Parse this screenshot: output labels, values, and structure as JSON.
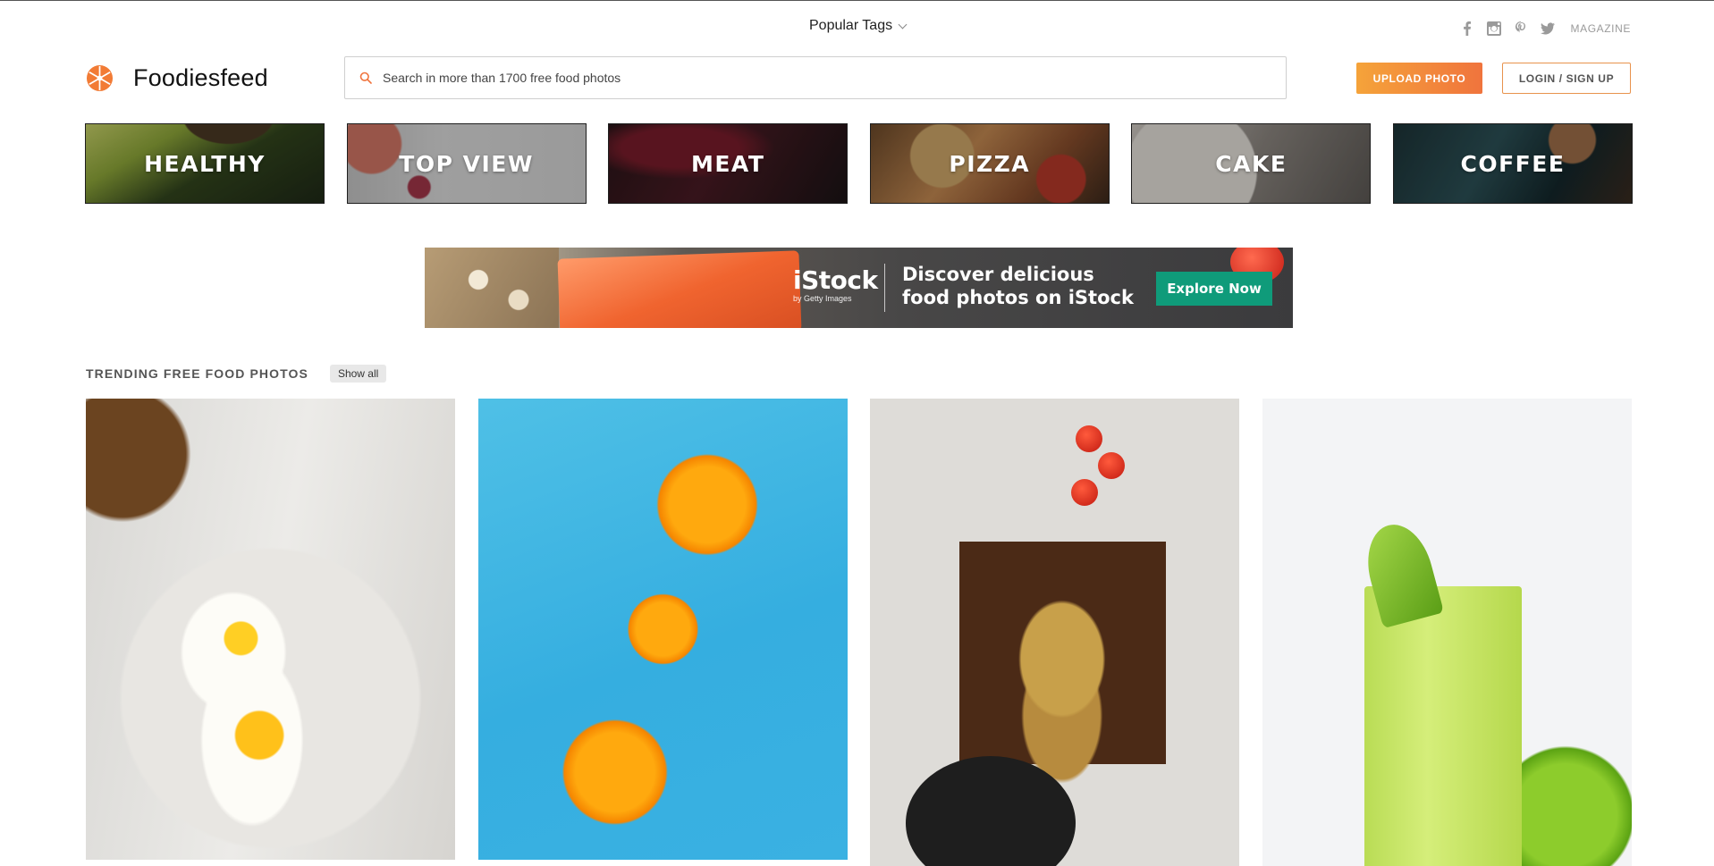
{
  "header": {
    "popular_tags_label": "Popular Tags",
    "magazine_label": "MAGAZINE",
    "social_icons": [
      "facebook-icon",
      "instagram-icon",
      "pinterest-icon",
      "twitter-icon"
    ]
  },
  "brand": {
    "name": "Foodiesfeed",
    "accent_color": "#f0743d"
  },
  "search": {
    "placeholder": "Search in more than 1700 free food photos",
    "value": ""
  },
  "actions": {
    "upload_label": "UPLOAD PHOTO",
    "login_label": "LOGIN / SIGN UP"
  },
  "categories": [
    {
      "label": "HEALTHY"
    },
    {
      "label": "TOP VIEW"
    },
    {
      "label": "MEAT"
    },
    {
      "label": "PIZZA"
    },
    {
      "label": "CAKE"
    },
    {
      "label": "COFFEE"
    }
  ],
  "ad": {
    "brand": "iStock",
    "brand_sub": "by Getty Images",
    "headline": "Discover delicious food photos on iStock",
    "cta": "Explore Now",
    "cta_color": "#0f9b7a"
  },
  "trending": {
    "title": "TRENDING FREE FOOD PHOTOS",
    "show_all_label": "Show all"
  }
}
